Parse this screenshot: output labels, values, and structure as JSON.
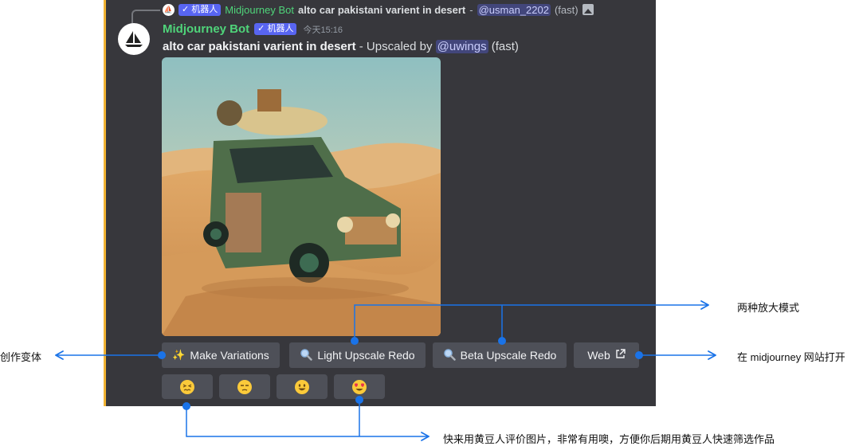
{
  "reply": {
    "badge": "✓ 机器人",
    "bot_name": "Midjourney Bot",
    "prompt": "alto car pakistani varient in desert",
    "separator": "-",
    "mention": "@usman_2202",
    "speed": "(fast)",
    "icon": "image-icon"
  },
  "message": {
    "bot_name": "Midjourney Bot",
    "badge": "✓ 机器人",
    "timestamp": "今天15:16",
    "prompt": "alto car pakistani varient in desert",
    "status": "- Upscaled by",
    "mention": "@uwings",
    "speed": "(fast)"
  },
  "buttons": {
    "make_variations": "Make Variations",
    "light_upscale": "Light Upscale Redo",
    "beta_upscale": "Beta Upscale Redo",
    "web": "Web"
  },
  "reactions": [
    "persevere-emoji",
    "unamused-emoji",
    "smiley-emoji",
    "heart-eyes-emoji"
  ],
  "annotations": {
    "upscale_modes": "两种放大模式",
    "variations": "创作变体",
    "website": "在 midjourney 网站打开",
    "rating": "快来用黄豆人评价图片，非常有用噢，方便你后期用黄豆人快速筛选作品"
  },
  "colors": {
    "background": "#37373c",
    "accent_bar": "#f0b232",
    "bot_name": "#4fd47a",
    "badge": "#5865f2",
    "button": "#4e5058",
    "arrow": "#1a73e8"
  }
}
